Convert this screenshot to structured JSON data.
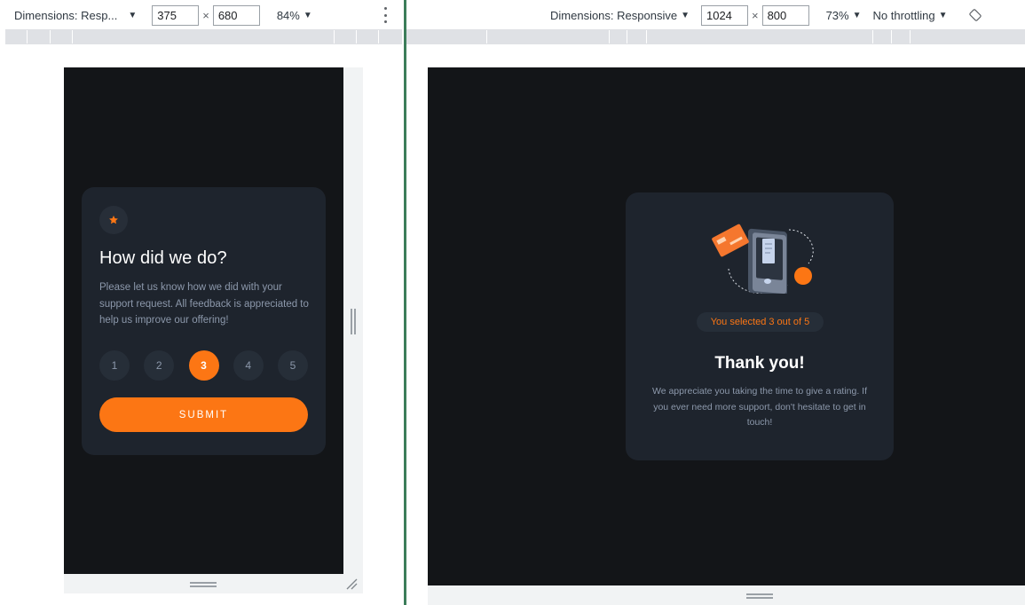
{
  "left_toolbar": {
    "dimensions_label": "Dimensions: Resp...",
    "width_value": "375",
    "times": "×",
    "height_value": "680",
    "zoom": "84%",
    "more_icon": "kebab-menu-icon"
  },
  "right_toolbar": {
    "dimensions_label": "Dimensions: Responsive",
    "width_value": "1024",
    "times": "×",
    "height_value": "800",
    "zoom": "73%",
    "throttling": "No throttling",
    "rotate_icon": "rotate-icon"
  },
  "rating_card": {
    "icon": "star-icon",
    "title": "How did we do?",
    "description": "Please let us know how we did with your support request. All feedback is appreciated to help us improve our offering!",
    "ratings": [
      "1",
      "2",
      "3",
      "4",
      "5"
    ],
    "selected_rating": "3",
    "submit_label": "SUBMIT"
  },
  "thanks_card": {
    "illustration": "payment-phone-illustration",
    "selected_text": "You selected 3 out of 5",
    "title": "Thank you!",
    "description": "We appreciate you taking the time to give a rating. If you ever need more support, don't hesitate to get in touch!"
  },
  "colors": {
    "accent": "#fc7614",
    "card_bg": "#1e242d",
    "page_bg": "#131518",
    "muted_text": "#8c98ab",
    "button_bg": "#262e38"
  }
}
